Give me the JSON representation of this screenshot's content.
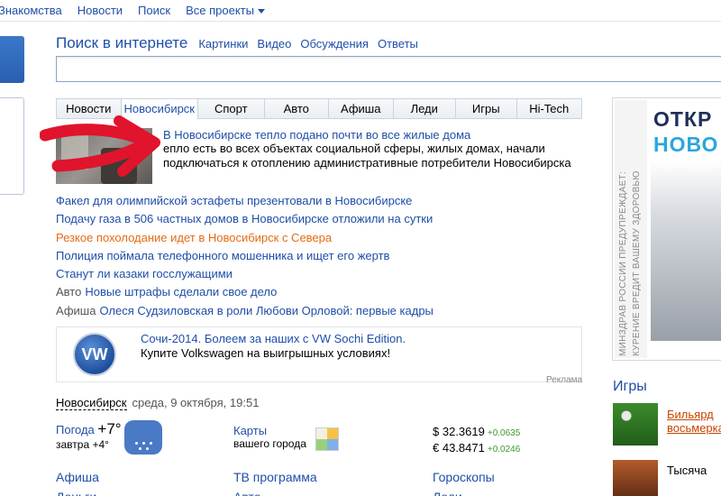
{
  "topnav": {
    "items": [
      "Знакомства",
      "Новости",
      "Поиск",
      "Все проекты"
    ]
  },
  "search": {
    "title": "Поиск в интернете",
    "links": [
      "Картинки",
      "Видео",
      "Обсуждения",
      "Ответы"
    ],
    "query": ""
  },
  "tabs": [
    {
      "label": "Новости",
      "active": false
    },
    {
      "label": "Новосибирск",
      "active": true
    },
    {
      "label": "Спорт",
      "active": false
    },
    {
      "label": "Авто",
      "active": false
    },
    {
      "label": "Афиша",
      "active": false
    },
    {
      "label": "Леди",
      "active": false
    },
    {
      "label": "Игры",
      "active": false
    },
    {
      "label": "Hi-Tech",
      "active": false
    }
  ],
  "lead": {
    "title": "В Новосибирске тепло подано почти во все жилые дома",
    "text": "епло есть во всех объектах социальной сферы, жилых домах, начали подключаться к отоплению административные потребители Новосибирска"
  },
  "news": [
    {
      "category": "",
      "text": "Факел для олимпийской эстафеты презентовали в Новосибирске",
      "highlight": false
    },
    {
      "category": "",
      "text": "Подачу газа в 506 частных домов в Новосибирске отложили на сутки",
      "highlight": false
    },
    {
      "category": "",
      "text": "Резкое похолодание идет в Новосибирск с Севера",
      "highlight": true
    },
    {
      "category": "",
      "text": "Полиция поймала телефонного мошенника и ищет его жертв",
      "highlight": false
    },
    {
      "category": "",
      "text": "Станут ли казаки госслужащими",
      "highlight": false
    },
    {
      "category": "Авто",
      "text": "Новые штрафы сделали свое дело",
      "highlight": false
    },
    {
      "category": "Афиша",
      "text": "Олеся Судзиловская в роли Любови Орловой: первые кадры",
      "highlight": false
    }
  ],
  "ad": {
    "title": "Сочи-2014. Болеем за наших с VW Sochi Edition.",
    "text": "Купите Volkswagen на выигрышных условиях!",
    "label": "Реклама",
    "logo": "VW"
  },
  "cityinfo": {
    "city": "Новосибирск",
    "date": "среда, 9 октября, 19:51"
  },
  "weather": {
    "label": "Погода",
    "now": "+7°",
    "tomorrow": "завтра +4°",
    "icon": "rain-cloud-icon"
  },
  "maps": {
    "label": "Карты",
    "sub": "вашего города",
    "icon": "map-icon"
  },
  "rates": [
    {
      "symbol": "$",
      "value": "32.3619",
      "change": "+0.0635"
    },
    {
      "symbol": "€",
      "value": "43.8471",
      "change": "+0.0246"
    }
  ],
  "bottomlinks": [
    "Афиша",
    "ТВ программа",
    "Гороскопы"
  ],
  "bottomcut": [
    "Деньги",
    "Авто",
    "Леди"
  ],
  "banner": {
    "warning_line1": "МИНЗДРАВ РОССИИ ПРЕДУПРЕЖДАЕТ:",
    "warning_line2": "КУРЕНИЕ ВРЕДИТ ВАШЕМУ ЗДОРОВЬЮ",
    "text1": "ОТКР",
    "text2": "НОВО"
  },
  "games": {
    "heading": "Игры",
    "items": [
      {
        "title": "Бильярд восьмерка",
        "title_line1": "Бильярд",
        "title_line2": "восьмерка"
      },
      {
        "title": "Тысяча"
      }
    ]
  },
  "colors": {
    "link": "#1f4ea8",
    "highlight": "#e56b13",
    "rate_change": "#3a9a2b"
  }
}
